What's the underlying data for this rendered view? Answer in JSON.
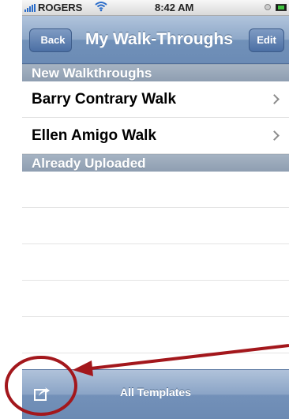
{
  "status_bar": {
    "carrier": "ROGERS",
    "time": "8:42 AM"
  },
  "nav": {
    "back_label": "Back",
    "title": "My Walk-Throughs",
    "edit_label": "Edit"
  },
  "sections": [
    {
      "header": "New Walkthroughs",
      "items": [
        "Barry Contrary Walk",
        "Ellen Amigo Walk"
      ]
    },
    {
      "header": "Already Uploaded",
      "items": []
    }
  ],
  "toolbar": {
    "title": "All Templates",
    "action_icon": "share-icon"
  },
  "colors": {
    "nav_blue": "#7d9bc2",
    "section_gray": "#98a8b9",
    "annotation_red": "#a3171c"
  }
}
